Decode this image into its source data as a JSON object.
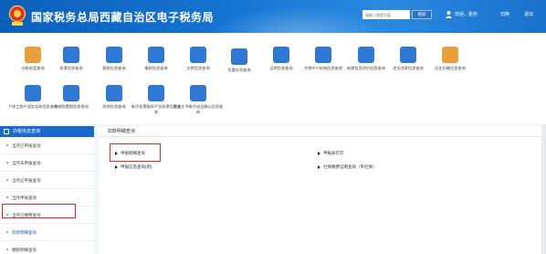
{
  "header": {
    "title": "国家税务总局西藏自治区电子税务局",
    "search_placeholder": "请输入搜索内容",
    "search_button": "搜索",
    "user_text": "欢迎，税务",
    "link_switch": "切换",
    "link_exit": "退出"
  },
  "quick_items": [
    {
      "label": "办税进度查询",
      "icon": "tax-progress-icon",
      "color": "#e8a13a"
    },
    {
      "label": "发票信息查询",
      "icon": "invoice-info-icon",
      "color": "#2f78d4"
    },
    {
      "label": "税款信息查询",
      "icon": "tax-payment-icon",
      "color": "#2f78d4"
    },
    {
      "label": "缴款信息查询",
      "icon": "payment-info-icon",
      "color": "#2f78d4"
    },
    {
      "label": "欠税信息查询",
      "icon": "arrears-icon",
      "color": "#2f78d4"
    },
    {
      "label": "优惠信息查询",
      "icon": "preferential-icon",
      "color": "#2f78d4"
    },
    {
      "label": "证明信息查询",
      "icon": "certificate-icon",
      "color": "#2f78d4"
    },
    {
      "label": "涉税中介机构信息查询",
      "icon": "agency-icon",
      "color": "#2f78d4"
    },
    {
      "label": "纳税信用评价信息查询",
      "icon": "credit-icon",
      "color": "#2f78d4"
    },
    {
      "label": "违法违章信息查询",
      "icon": "violation-icon",
      "color": "#2f78d4"
    },
    {
      "label": "历史扣缴信息查询",
      "icon": "history-icon",
      "color": "#e8a13a"
    },
    {
      "label": "个体工商户双定征收信息查询",
      "icon": "individual-business-icon",
      "color": "#2f78d4"
    },
    {
      "label": "车辆购置税信息查询",
      "icon": "vehicle-tax-icon",
      "color": "#2f78d4"
    },
    {
      "label": "其他信息查询",
      "icon": "other-info-icon",
      "color": "#2f78d4"
    },
    {
      "label": "电子发票服务平台发票信息查询",
      "icon": "e-invoice-icon",
      "color": "#2f78d4"
    },
    {
      "label": "税务文书电子送达确认信息查询",
      "icon": "document-icon",
      "color": "#2f78d4"
    }
  ],
  "left_menu": {
    "heading": "办税信息查询",
    "items": [
      {
        "label": "当月已申报查询"
      },
      {
        "label": "当月未申报查询"
      },
      {
        "label": "当月应申报查询"
      },
      {
        "label": "当月申报查询"
      },
      {
        "label": "当月已缴费查询"
      },
      {
        "label": "扣款明细查询",
        "selected": true
      },
      {
        "label": "缴税明细查询"
      },
      {
        "label": "缴费信息查询"
      }
    ]
  },
  "right_panel": {
    "heading": "扣款明细查询",
    "links": [
      {
        "label": "申报明细查询",
        "highlighted": true
      },
      {
        "label": "申报表打印"
      },
      {
        "label": "申报信息查询(新)"
      },
      {
        "label": "社保缴费证明查询（单社保）"
      }
    ]
  },
  "colors": {
    "header_blue": "#1676d3",
    "accent_blue": "#1b6ac9",
    "highlight_red": "#e02a2a"
  }
}
